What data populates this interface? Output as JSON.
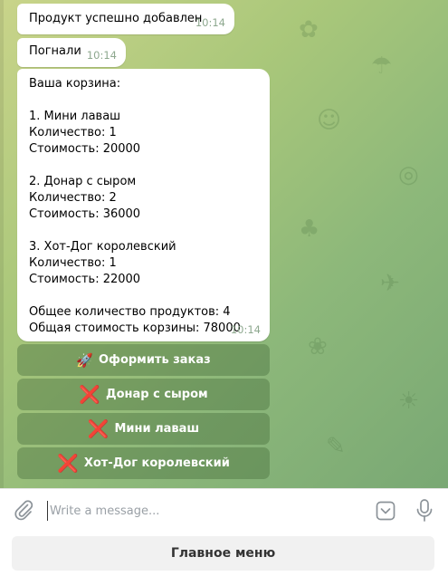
{
  "messages": [
    {
      "text": "Продукт успешно добавлен",
      "time": "10:14"
    },
    {
      "text": "Погнали",
      "time": "10:14"
    },
    {
      "text": "Ваша корзина:\n\n1. Мини лаваш\nКоличество: 1\nСтоимость: 20000\n\n2. Донар с сыром\nКоличество: 2\nСтоимость: 36000\n\n3. Хот-Дог королевский\nКоличество: 1\nСтоимость: 22000\n\nОбщее количество продуктов: 4\nОбщая стоимость корзины: 78000",
      "time": "10:14"
    }
  ],
  "inline_buttons": [
    {
      "icon": "🚀",
      "label": "Оформить заказ"
    },
    {
      "icon": "❌",
      "label": "Донар с сыром"
    },
    {
      "icon": "❌",
      "label": "Мини лаваш"
    },
    {
      "icon": "❌",
      "label": "Хот-Дог королевский"
    }
  ],
  "composer": {
    "placeholder": "Write a message..."
  },
  "keyboard": {
    "main_menu_label": "Главное меню"
  },
  "icons": {
    "attach": "paperclip-icon",
    "bot_commands": "bot-command-icon",
    "mic": "microphone-icon",
    "rocket": "rocket-icon",
    "cross": "cross-mark-icon"
  },
  "colors": {
    "wallpaper": "#a9c77a",
    "button_overlay": "#486e3c",
    "cross": "#e0262d"
  }
}
